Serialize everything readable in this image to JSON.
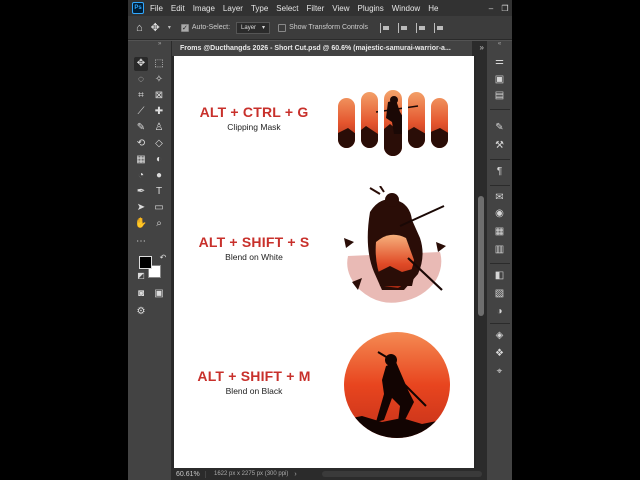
{
  "menubar": {
    "logo": "Ps",
    "items": [
      "File",
      "Edit",
      "Image",
      "Layer",
      "Type",
      "Select",
      "Filter",
      "View",
      "Plugins",
      "Window",
      "He"
    ],
    "window_buttons": [
      "–",
      "❐"
    ]
  },
  "options": {
    "auto_select_label": "Auto-Select:",
    "auto_select_value": "Layer",
    "show_transform_label": "Show Transform Controls"
  },
  "document": {
    "tab_title": "Froms @Ducthangds 2026 - Short Cut.psd @ 60.6% (majestic-samurai-warrior-a...",
    "zoom": "60.61%",
    "info": "1622 px x 2275 px (300 ppi)"
  },
  "shortcuts": [
    {
      "keys": "ALT + CTRL + G",
      "label": "Clipping Mask"
    },
    {
      "keys": "ALT + SHIFT + S",
      "label": "Blend on White"
    },
    {
      "keys": "ALT + SHIFT + M",
      "label": "Blend on Black"
    }
  ],
  "colors": {
    "accent_red": "#c8302b",
    "panel_dark": "#323232",
    "artboard": "#ffffff"
  }
}
